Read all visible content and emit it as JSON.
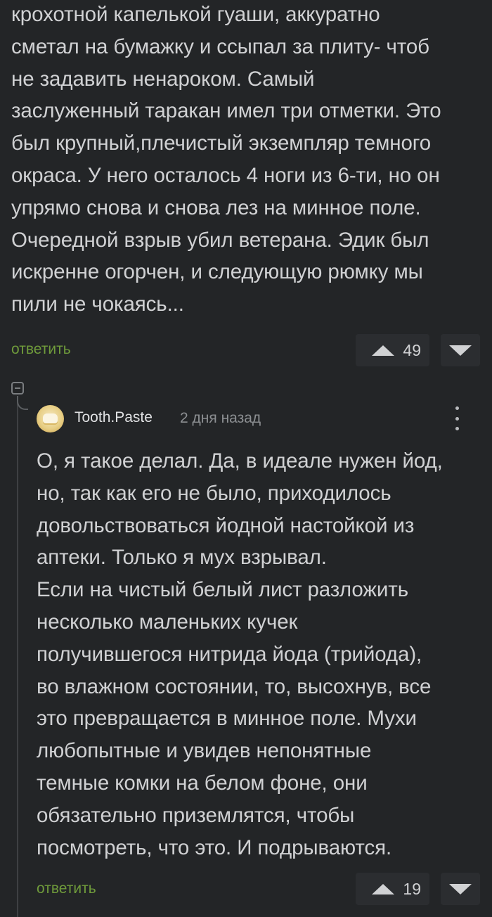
{
  "parent_comment": {
    "lines": [
      "крохотной капелькой гуаши, аккуратно",
      "сметал на бумажку и ссыпал за плиту- чтоб",
      "не задавить ненароком. Самый",
      "заслуженный таракан имел три отметки. Это",
      "был крупный,плечистый экземпляр темного",
      "окраса. У него осталось 4 ноги из 6-ти, но он",
      "упрямо снова и снова лез на минное поле.",
      "Очередной взрыв убил ветерана. Эдик был",
      "искренне огорчен, и следующую рюмку мы",
      "пили не чокаясь..."
    ],
    "reply_label": "ответить",
    "rating": "49"
  },
  "child_comment": {
    "author": "Tooth.Paste",
    "time": "2 дня назад",
    "avatar_icon": "cream-puff-avatar",
    "lines": [
      "О, я такое делал. Да, в идеале нужен йод,",
      "но, так как его не было, приходилось",
      "довольствоваться йодной настойкой из",
      "аптеки. Только я мух взрывал.",
      "Если на чистый белый лист разложить",
      "несколько маленьких кучек",
      "получившегося нитрида йода (трийода),",
      "во влажном состоянии, то, высохнув, все",
      "это превращается в минное поле. Мухи",
      "любопытные и увидев непонятные",
      "темные комки на белом фоне, они",
      "обязательно приземлятся, чтобы",
      "посмотреть, что это. И подрываются."
    ],
    "reply_label": "ответить",
    "rating": "19"
  },
  "colors": {
    "background": "#232527",
    "text": "#d0d1d3",
    "reply_link": "#6f9b3b",
    "vote_box": "#2b2d30",
    "muted": "#8c8f92"
  }
}
